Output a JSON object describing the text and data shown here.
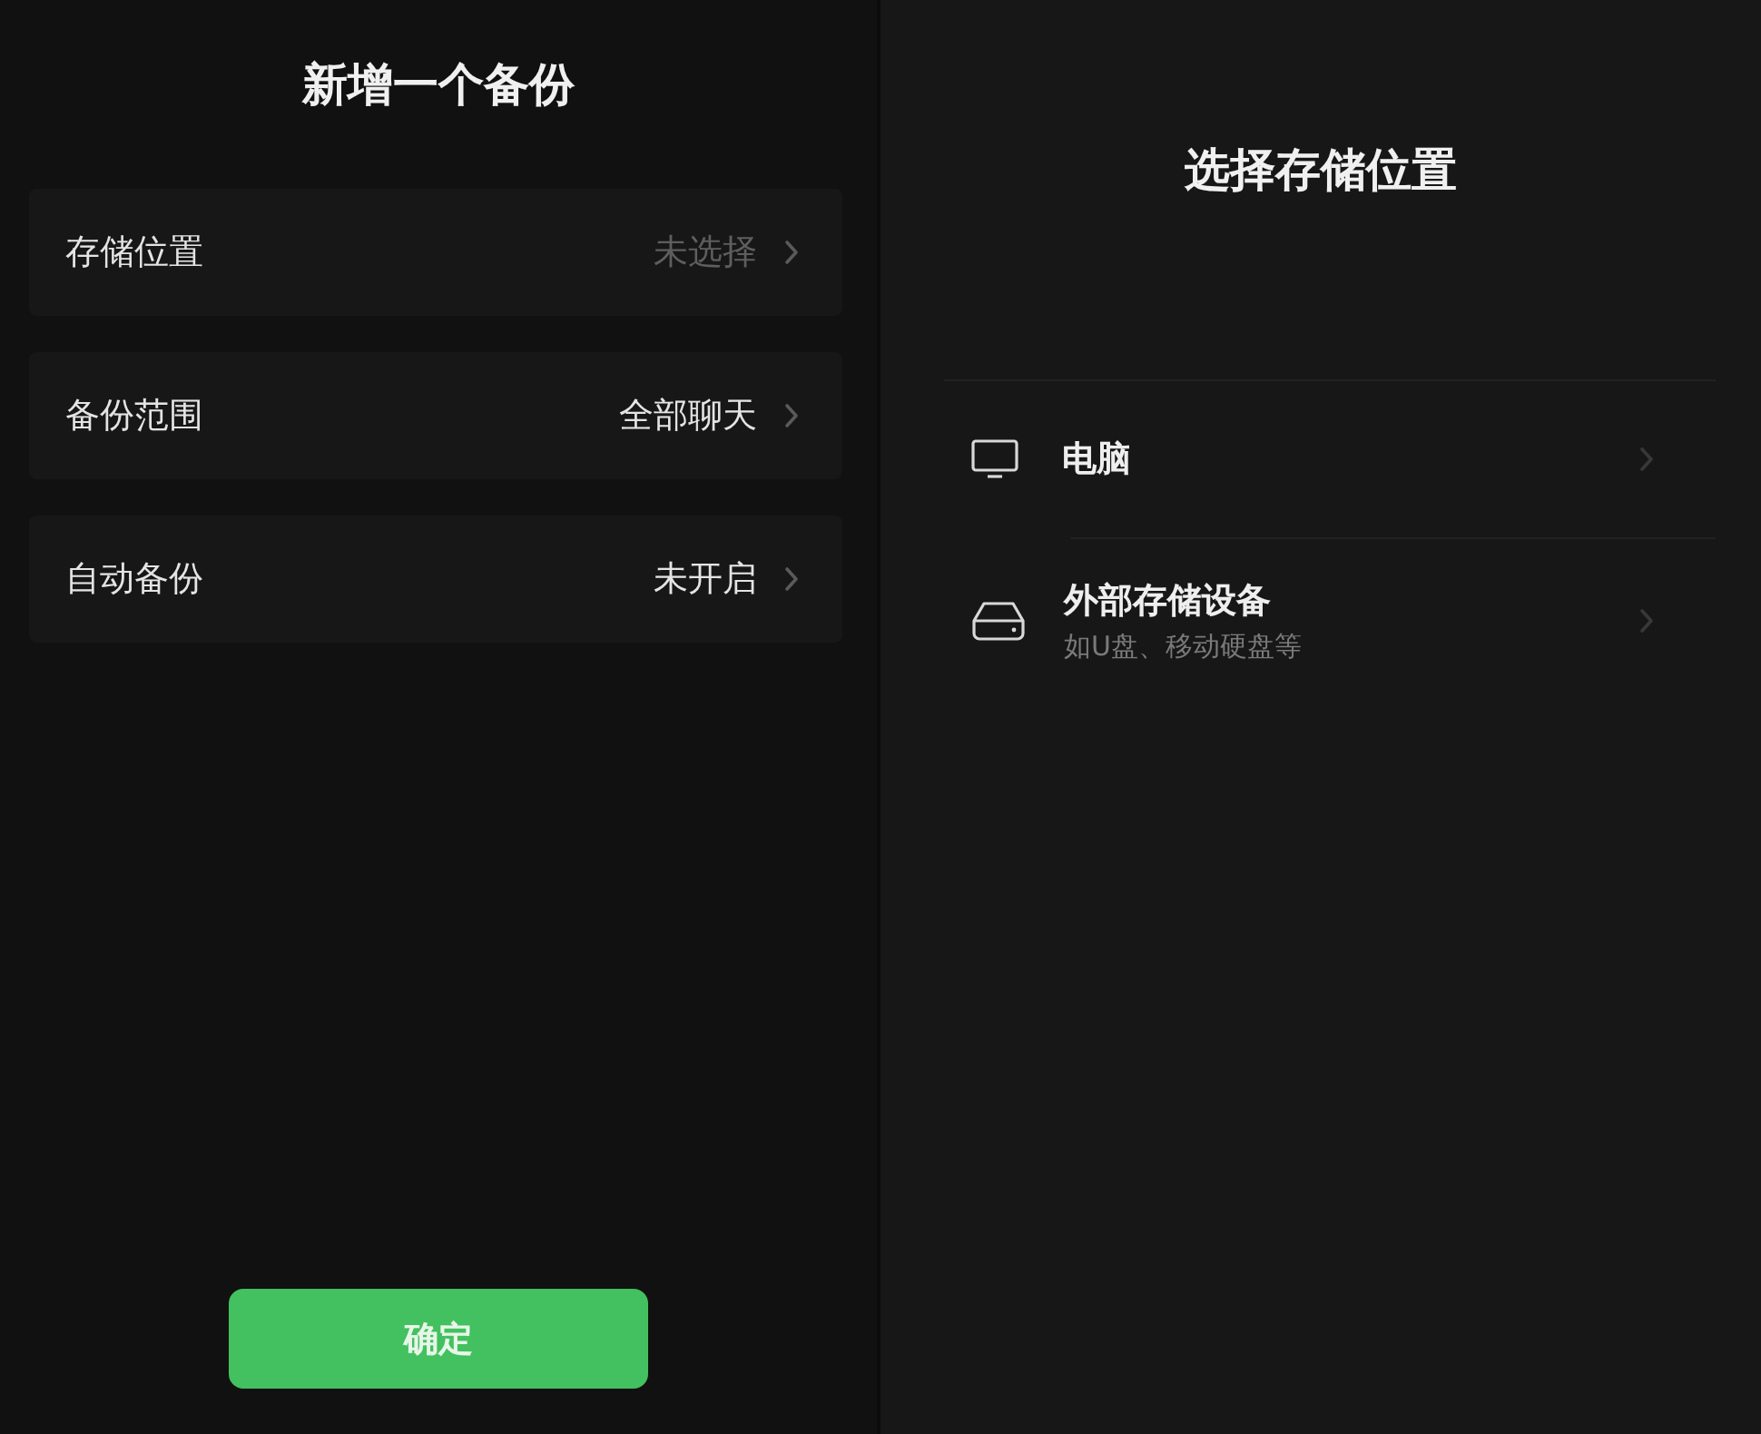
{
  "left_panel": {
    "title": "新增一个备份",
    "rows": [
      {
        "label": "存储位置",
        "value": "未选择",
        "dimmed": true
      },
      {
        "label": "备份范围",
        "value": "全部聊天",
        "dimmed": false
      },
      {
        "label": "自动备份",
        "value": "未开启",
        "dimmed": false
      }
    ],
    "confirm_button": "确定"
  },
  "right_panel": {
    "title": "选择存储位置",
    "options": [
      {
        "kind": "computer",
        "title": "电脑"
      },
      {
        "kind": "external",
        "title": "外部存储设备",
        "subtitle": "如U盘、移动硬盘等"
      }
    ]
  }
}
